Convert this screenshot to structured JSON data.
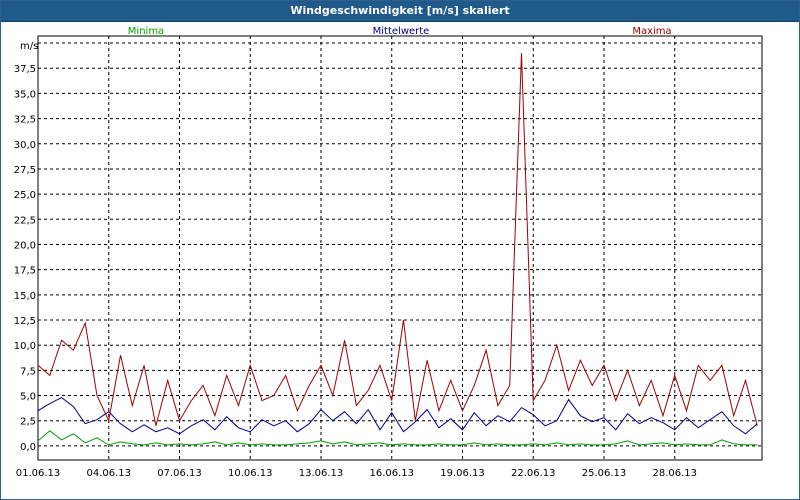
{
  "window": {
    "title": "Windgeschwindigkeit [m/s] skaliert"
  },
  "chart_data": {
    "type": "line",
    "title": "Windgeschwindigkeit [m/s] skaliert",
    "ylabel": "m/s",
    "xlabel": "",
    "ylim": [
      -1.4,
      40.7
    ],
    "yticks": [
      "0,0",
      "2,5",
      "5,0",
      "7,5",
      "10,0",
      "12,5",
      "15,0",
      "17,5",
      "20,0",
      "22,5",
      "25,0",
      "27,5",
      "30,0",
      "32,5",
      "35,0",
      "37,5"
    ],
    "ytick_values": [
      0,
      2.5,
      5,
      7.5,
      10,
      12.5,
      15,
      17.5,
      20,
      22.5,
      25,
      27.5,
      30,
      32.5,
      35,
      37.5
    ],
    "xlim": [
      0,
      30.7
    ],
    "xticks": [
      "01.06.13",
      "04.06.13",
      "07.06.13",
      "10.06.13",
      "13.06.13",
      "16.06.13",
      "19.06.13",
      "22.06.13",
      "25.06.13",
      "28.06.13"
    ],
    "xtick_values": [
      0,
      3,
      6,
      9,
      12,
      15,
      18,
      21,
      24,
      27
    ],
    "grid": true,
    "legend_placement": "top",
    "series": [
      {
        "name": "Minima",
        "color": "#00a000",
        "x": [
          0,
          0.5,
          1,
          1.5,
          2,
          2.5,
          3,
          3.5,
          4,
          4.5,
          5,
          5.5,
          6,
          6.5,
          7,
          7.5,
          8,
          8.5,
          9,
          9.5,
          10,
          10.5,
          11,
          11.5,
          12,
          12.5,
          13,
          13.5,
          14,
          14.5,
          15,
          15.5,
          16,
          16.5,
          17,
          17.5,
          18,
          18.5,
          19,
          19.5,
          20,
          20.5,
          21,
          21.5,
          22,
          22.5,
          23,
          23.5,
          24,
          24.5,
          25,
          25.5,
          26,
          26.5,
          27,
          27.5,
          28,
          28.5,
          29,
          29.5,
          30,
          30.5
        ],
        "values": [
          0.5,
          1.5,
          0.6,
          1.2,
          0.3,
          0.8,
          0.1,
          0.4,
          0.2,
          0.1,
          0.3,
          0.1,
          0.2,
          0.1,
          0.2,
          0.4,
          0.1,
          0.3,
          0.1,
          0.2,
          0.1,
          0.1,
          0.2,
          0.3,
          0.5,
          0.2,
          0.4,
          0.1,
          0.2,
          0.3,
          0.1,
          0.2,
          0.1,
          0.1,
          0.2,
          0.1,
          0.1,
          0.3,
          0.1,
          0.2,
          0.1,
          0.1,
          0.2,
          0.1,
          0.3,
          0.1,
          0.2,
          0.1,
          0.1,
          0.2,
          0.5,
          0.1,
          0.2,
          0.3,
          0.1,
          0.2,
          0.1,
          0.1,
          0.6,
          0.2,
          0.1,
          0.1
        ]
      },
      {
        "name": "Mittelwerte",
        "color": "#000090",
        "x": [
          0,
          0.5,
          1,
          1.5,
          2,
          2.5,
          3,
          3.5,
          4,
          4.5,
          5,
          5.5,
          6,
          6.5,
          7,
          7.5,
          8,
          8.5,
          9,
          9.5,
          10,
          10.5,
          11,
          11.5,
          12,
          12.5,
          13,
          13.5,
          14,
          14.5,
          15,
          15.5,
          16,
          16.5,
          17,
          17.5,
          18,
          18.5,
          19,
          19.5,
          20,
          20.5,
          21,
          21.5,
          22,
          22.5,
          23,
          23.5,
          24,
          24.5,
          25,
          25.5,
          26,
          26.5,
          27,
          27.5,
          28,
          28.5,
          29,
          29.5,
          30,
          30.5
        ],
        "values": [
          3.5,
          4.2,
          4.8,
          3.9,
          2.2,
          2.6,
          3.4,
          2.2,
          1.4,
          2.1,
          1.4,
          1.8,
          1.2,
          2.0,
          2.6,
          1.6,
          2.9,
          1.8,
          1.4,
          2.6,
          2.0,
          2.5,
          1.4,
          2.2,
          3.6,
          2.5,
          3.4,
          2.2,
          3.6,
          1.6,
          3.3,
          1.4,
          2.4,
          3.6,
          1.8,
          2.7,
          1.6,
          3.3,
          2.0,
          3.0,
          2.4,
          3.8,
          3.1,
          2.0,
          2.5,
          4.6,
          3.0,
          2.4,
          2.8,
          1.6,
          3.2,
          2.2,
          2.8,
          2.3,
          1.6,
          2.8,
          1.8,
          2.6,
          3.4,
          2.0,
          1.2,
          2.2
        ]
      },
      {
        "name": "Maxima",
        "color": "#a00000",
        "x": [
          0,
          0.5,
          1,
          1.5,
          2,
          2.5,
          3,
          3.5,
          4,
          4.5,
          5,
          5.5,
          6,
          6.5,
          7,
          7.5,
          8,
          8.5,
          9,
          9.5,
          10,
          10.5,
          11,
          11.5,
          12,
          12.5,
          13,
          13.5,
          14,
          14.5,
          15,
          15.5,
          16,
          16.5,
          17,
          17.5,
          18,
          18.5,
          19,
          19.5,
          20,
          20.5,
          21,
          21.5,
          22,
          22.5,
          23,
          23.5,
          24,
          24.5,
          25,
          25.5,
          26,
          26.5,
          27,
          27.5,
          28,
          28.5,
          29,
          29.5,
          30,
          30.5
        ],
        "values": [
          8.0,
          7.0,
          10.5,
          9.5,
          12.2,
          5.0,
          2.5,
          9.0,
          4.0,
          8.0,
          2.0,
          6.5,
          2.5,
          4.5,
          6.0,
          3.0,
          7.0,
          4.0,
          8.0,
          4.5,
          5.0,
          7.0,
          3.5,
          6.0,
          8.0,
          5.0,
          10.5,
          4.0,
          5.5,
          8.0,
          4.5,
          12.5,
          2.5,
          8.5,
          3.5,
          6.5,
          3.5,
          6.0,
          9.5,
          4.0,
          6.0,
          39.0,
          4.5,
          6.5,
          10.0,
          5.5,
          8.5,
          6.0,
          8.0,
          4.5,
          7.5,
          4.0,
          6.5,
          3.0,
          7.0,
          3.5,
          8.0,
          6.5,
          8.0,
          3.0,
          6.5,
          2.0
        ]
      }
    ]
  }
}
